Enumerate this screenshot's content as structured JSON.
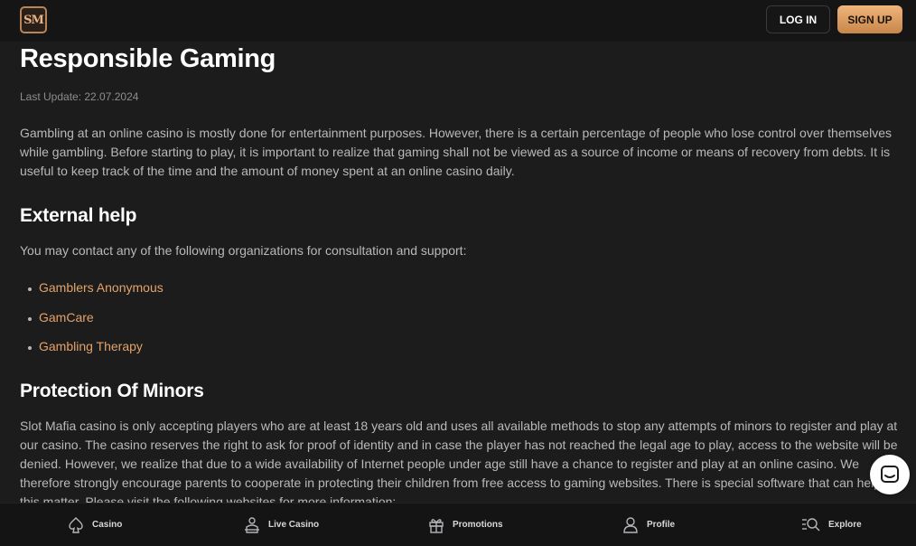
{
  "header": {
    "logo_text": "SM",
    "login_label": "LOG IN",
    "signup_label": "SIGN UP",
    "accent_color": "#e2a26a"
  },
  "page": {
    "title": "Responsible Gaming",
    "last_update": "Last Update: 22.07.2024",
    "intro": "Gambling at an online casino is mostly done for entertainment purposes. However, there is a certain percentage of people who lose control over themselves while gambling. Before starting to play, it is important to realize that gaming shall not be viewed as a source of income or means of recovery from debts. It is useful to keep track of the time and the amount of money spent at an online casino daily.",
    "external_help": {
      "heading": "External help",
      "text": "You may contact any of the following organizations for consultation and support:",
      "links": [
        "Gamblers Anonymous",
        "GamCare",
        "Gambling Therapy"
      ]
    },
    "minors": {
      "heading": "Protection Of Minors",
      "text": "Slot Mafia casino is only accepting players who are at least 18 years old and uses all available methods to stop any attempts of minors to register and play at our casino. The casino reserves the right to ask for proof of identity and in case the player has not reached the legal age to play, access to the website will be denied. However, we realize that due to a wide availability of Internet people under age still have a chance to register and play at an online casino. We therefore strongly encourage parents to cooperate in protecting their children from free access to gaming websites. There is special software that can help in this matter. Please visit the following websites for more information:"
    }
  },
  "bottom_nav": {
    "items": [
      {
        "label": "Casino",
        "icon": "spade-icon"
      },
      {
        "label": "Live Casino",
        "icon": "dealer-icon"
      },
      {
        "label": "Promotions",
        "icon": "gift-icon"
      },
      {
        "label": "Profile",
        "icon": "user-icon"
      },
      {
        "label": "Explore",
        "icon": "search-list-icon"
      }
    ]
  },
  "chat": {
    "icon": "chat-icon"
  }
}
